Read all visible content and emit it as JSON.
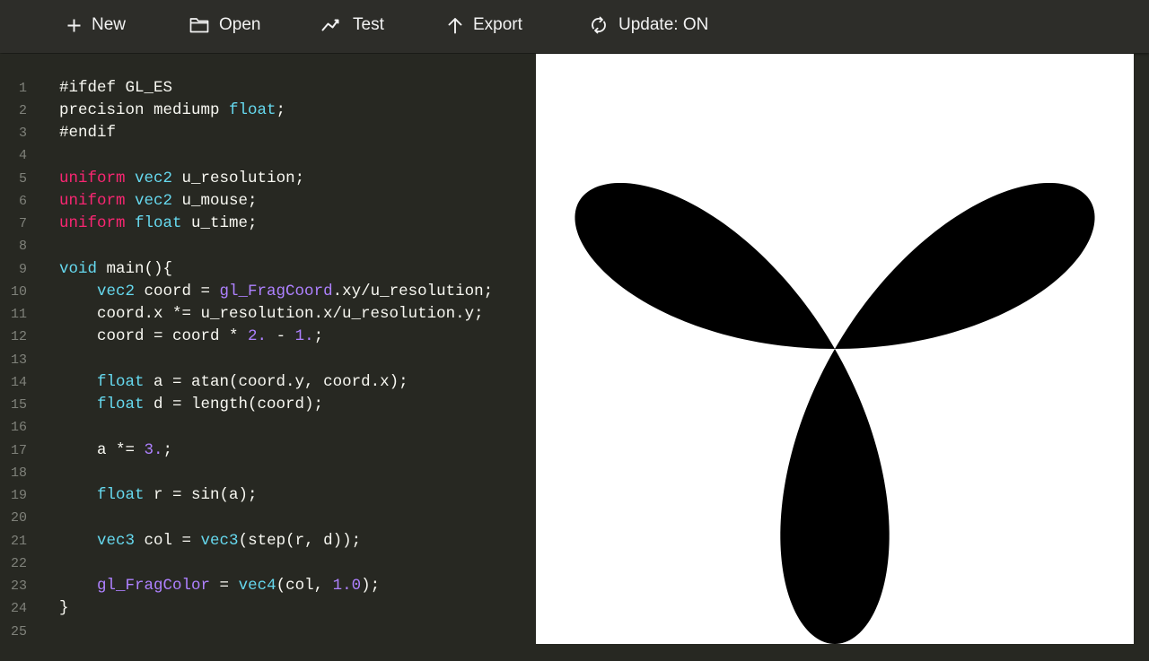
{
  "toolbar": {
    "buttons": [
      {
        "label": "New",
        "icon": "plus-icon"
      },
      {
        "label": "Open",
        "icon": "folder-icon"
      },
      {
        "label": "Test",
        "icon": "trend-line-icon"
      },
      {
        "label": "Export",
        "icon": "arrow-up-icon"
      },
      {
        "label": "Update: ON",
        "icon": "refresh-icon"
      }
    ]
  },
  "colors": {
    "editor_background": "#272822",
    "toolbar_background": "#2d2d29",
    "plain_text": "#f8f8f2",
    "keyword": "#f92672",
    "type": "#66d9ef",
    "number": "#ae81ff",
    "builtin": "#ae81ff",
    "line_number": "#7f817a",
    "canvas_background": "#ffffff",
    "canvas_shape": "#000000"
  },
  "editor": {
    "lines": [
      {
        "n": "1",
        "tokens": [
          {
            "t": "#ifdef GL_ES",
            "c": "plain"
          }
        ]
      },
      {
        "n": "2",
        "tokens": [
          {
            "t": "precision mediump ",
            "c": "plain"
          },
          {
            "t": "float",
            "c": "type"
          },
          {
            "t": ";",
            "c": "plain"
          }
        ]
      },
      {
        "n": "3",
        "tokens": [
          {
            "t": "#endif",
            "c": "plain"
          }
        ]
      },
      {
        "n": "4",
        "tokens": []
      },
      {
        "n": "5",
        "tokens": [
          {
            "t": "uniform",
            "c": "keyword"
          },
          {
            "t": " ",
            "c": "plain"
          },
          {
            "t": "vec2",
            "c": "type"
          },
          {
            "t": " u_resolution;",
            "c": "plain"
          }
        ]
      },
      {
        "n": "6",
        "tokens": [
          {
            "t": "uniform",
            "c": "keyword"
          },
          {
            "t": " ",
            "c": "plain"
          },
          {
            "t": "vec2",
            "c": "type"
          },
          {
            "t": " u_mouse;",
            "c": "plain"
          }
        ]
      },
      {
        "n": "7",
        "tokens": [
          {
            "t": "uniform",
            "c": "keyword"
          },
          {
            "t": " ",
            "c": "plain"
          },
          {
            "t": "float",
            "c": "type"
          },
          {
            "t": " u_time;",
            "c": "plain"
          }
        ]
      },
      {
        "n": "8",
        "tokens": []
      },
      {
        "n": "9",
        "tokens": [
          {
            "t": "void",
            "c": "type"
          },
          {
            "t": " main(){",
            "c": "plain"
          }
        ]
      },
      {
        "n": "10",
        "tokens": [
          {
            "t": "    ",
            "c": "plain"
          },
          {
            "t": "vec2",
            "c": "type"
          },
          {
            "t": " coord = ",
            "c": "plain"
          },
          {
            "t": "gl_FragCoord",
            "c": "builtin"
          },
          {
            "t": ".xy/u_resolution;",
            "c": "plain"
          }
        ]
      },
      {
        "n": "11",
        "tokens": [
          {
            "t": "    coord.x *= u_resolution.x/u_resolution.y;",
            "c": "plain"
          }
        ]
      },
      {
        "n": "12",
        "tokens": [
          {
            "t": "    coord = coord * ",
            "c": "plain"
          },
          {
            "t": "2.",
            "c": "number"
          },
          {
            "t": " - ",
            "c": "plain"
          },
          {
            "t": "1.",
            "c": "number"
          },
          {
            "t": ";",
            "c": "plain"
          }
        ]
      },
      {
        "n": "13",
        "tokens": []
      },
      {
        "n": "14",
        "tokens": [
          {
            "t": "    ",
            "c": "plain"
          },
          {
            "t": "float",
            "c": "type"
          },
          {
            "t": " a = atan(coord.y, coord.x);",
            "c": "plain"
          }
        ]
      },
      {
        "n": "15",
        "tokens": [
          {
            "t": "    ",
            "c": "plain"
          },
          {
            "t": "float",
            "c": "type"
          },
          {
            "t": " d = length(coord);",
            "c": "plain"
          }
        ]
      },
      {
        "n": "16",
        "tokens": []
      },
      {
        "n": "17",
        "tokens": [
          {
            "t": "    a *= ",
            "c": "plain"
          },
          {
            "t": "3.",
            "c": "number"
          },
          {
            "t": ";",
            "c": "plain"
          }
        ]
      },
      {
        "n": "18",
        "tokens": []
      },
      {
        "n": "19",
        "tokens": [
          {
            "t": "    ",
            "c": "plain"
          },
          {
            "t": "float",
            "c": "type"
          },
          {
            "t": " r = sin(a);",
            "c": "plain"
          }
        ]
      },
      {
        "n": "20",
        "tokens": []
      },
      {
        "n": "21",
        "tokens": [
          {
            "t": "    ",
            "c": "plain"
          },
          {
            "t": "vec3",
            "c": "type"
          },
          {
            "t": " col = ",
            "c": "plain"
          },
          {
            "t": "vec3",
            "c": "type"
          },
          {
            "t": "(step(r, d));",
            "c": "plain"
          }
        ]
      },
      {
        "n": "22",
        "tokens": []
      },
      {
        "n": "23",
        "tokens": [
          {
            "t": "    ",
            "c": "plain"
          },
          {
            "t": "gl_FragColor",
            "c": "builtin"
          },
          {
            "t": " = ",
            "c": "plain"
          },
          {
            "t": "vec4",
            "c": "type"
          },
          {
            "t": "(col, ",
            "c": "plain"
          },
          {
            "t": "1.0",
            "c": "number"
          },
          {
            "t": ");",
            "c": "plain"
          }
        ]
      },
      {
        "n": "24",
        "tokens": [
          {
            "t": "}",
            "c": "plain"
          }
        ]
      },
      {
        "n": "25",
        "tokens": []
      }
    ]
  },
  "preview": {
    "shape": "three-petal rose",
    "petals": 3,
    "petal_angles_deg": [
      30,
      150,
      270
    ]
  }
}
